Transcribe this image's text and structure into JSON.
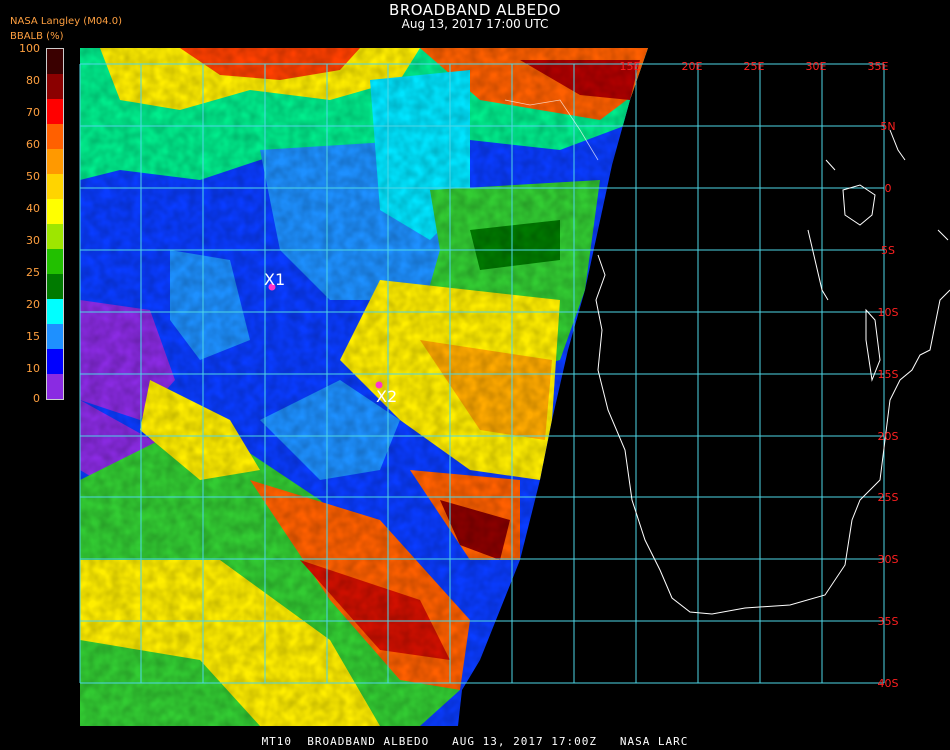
{
  "title": "BROADBAND ALBEDO",
  "subtitle": "Aug 13, 2017 17:00 UTC",
  "credit": "NASA Langley (M04.0)",
  "units": "BBALB (%)",
  "legend": {
    "ticks": [
      "100",
      "80",
      "70",
      "60",
      "50",
      "40",
      "30",
      "25",
      "20",
      "15",
      "10",
      "0"
    ],
    "colors": [
      "#3a0000",
      "#8b0000",
      "#ff0000",
      "#ff6000",
      "#ff9900",
      "#ffd400",
      "#ffff00",
      "#9ee600",
      "#22c000",
      "#007a00",
      "#00ffff",
      "#1e90ff",
      "#0000ff",
      "#8a2be2"
    ]
  },
  "grid": {
    "lon_labels": [
      "15E",
      "20E",
      "25E",
      "30E",
      "35E"
    ],
    "lat_labels": [
      "5N",
      "0",
      "5S",
      "10S",
      "15S",
      "20S",
      "25S",
      "30S",
      "35S",
      "40S"
    ],
    "line_color": "#4ed6e6",
    "label_color": "#ff2020"
  },
  "markers": [
    {
      "label": "X1",
      "color": "#ff33cc"
    },
    {
      "label": "X2",
      "color": "#ff33cc"
    }
  ],
  "footer": "MT10  BROADBAND ALBEDO   AUG 13, 2017 17:00Z   NASA LARC"
}
